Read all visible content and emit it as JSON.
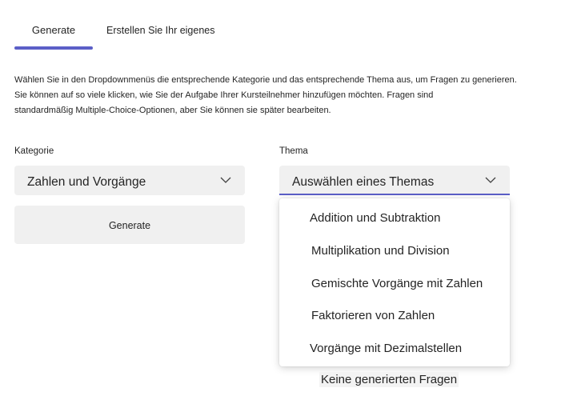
{
  "tabs": [
    {
      "label": "Generate",
      "active": true
    },
    {
      "label": "Erstellen Sie Ihr eigenes",
      "active": false
    }
  ],
  "accent_color": "#5b5fc7",
  "description": {
    "line1": "Wählen Sie in den Dropdownmenüs die entsprechende Kategorie und das entsprechende Thema aus, um Fragen zu generieren.",
    "line2": "Sie können auf so viele klicken, wie Sie der Aufgabe Ihrer Kursteilnehmer hinzufügen möchten. Fragen sind",
    "line3": "standardmäßig Multiple-Choice-Optionen, aber Sie können sie später bearbeiten."
  },
  "category": {
    "label": "Kategorie",
    "value": "Zahlen und Vorgänge",
    "icon": "chevron-down-icon"
  },
  "topic": {
    "label": "Thema",
    "placeholder": "Auswählen eines Themas",
    "icon": "chevron-up-icon",
    "options": [
      "Addition und Subtraktion",
      "Multiplikation und Division",
      "Gemischte Vorgänge mit Zahlen",
      "Faktorieren von Zahlen",
      "Vorgänge mit Dezimalstellen"
    ]
  },
  "generate_button": {
    "label": "Generate"
  },
  "empty_state": "Keine generierten Fragen"
}
